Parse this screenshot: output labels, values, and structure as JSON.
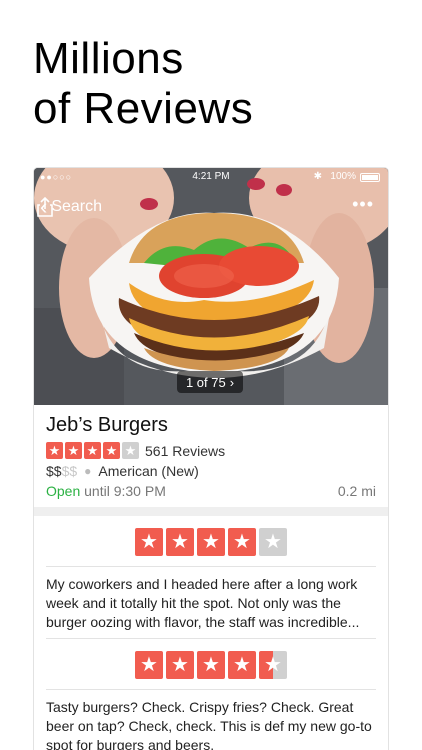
{
  "headline": {
    "line1": "Millions",
    "line2": "of Reviews"
  },
  "status_bar": {
    "signal": "●●○○○",
    "time": "4:21 PM",
    "bluetooth": "✱",
    "battery": "100%"
  },
  "nav": {
    "back_label": "Search",
    "share_icon": "share-icon",
    "more_icon": "more-icon"
  },
  "photo": {
    "counter": "1 of 75",
    "counter_chevron": "›"
  },
  "business": {
    "name": "Jeb’s Burgers",
    "rating": 4,
    "max_rating": 5,
    "review_count": "561 Reviews",
    "price_on": "$$",
    "price_off": "$$",
    "category": "American (New)",
    "open_status": "Open",
    "hours": "until 9:30 PM",
    "distance": "0.2 mi",
    "colors": {
      "star": "#f15c4f",
      "star_empty": "#d0d0d0",
      "open": "#2bb143"
    }
  },
  "reviews": [
    {
      "rating": 4,
      "text": "My coworkers and I headed here after a long work week and it totally hit the spot. Not only was the burger oozing with flavor, the staff was incredible..."
    },
    {
      "rating": 4.5,
      "text": "Tasty burgers? Check. Crispy fries? Check. Great beer on tap? Check, check. This is def my new go-to spot for burgers and beers."
    }
  ]
}
